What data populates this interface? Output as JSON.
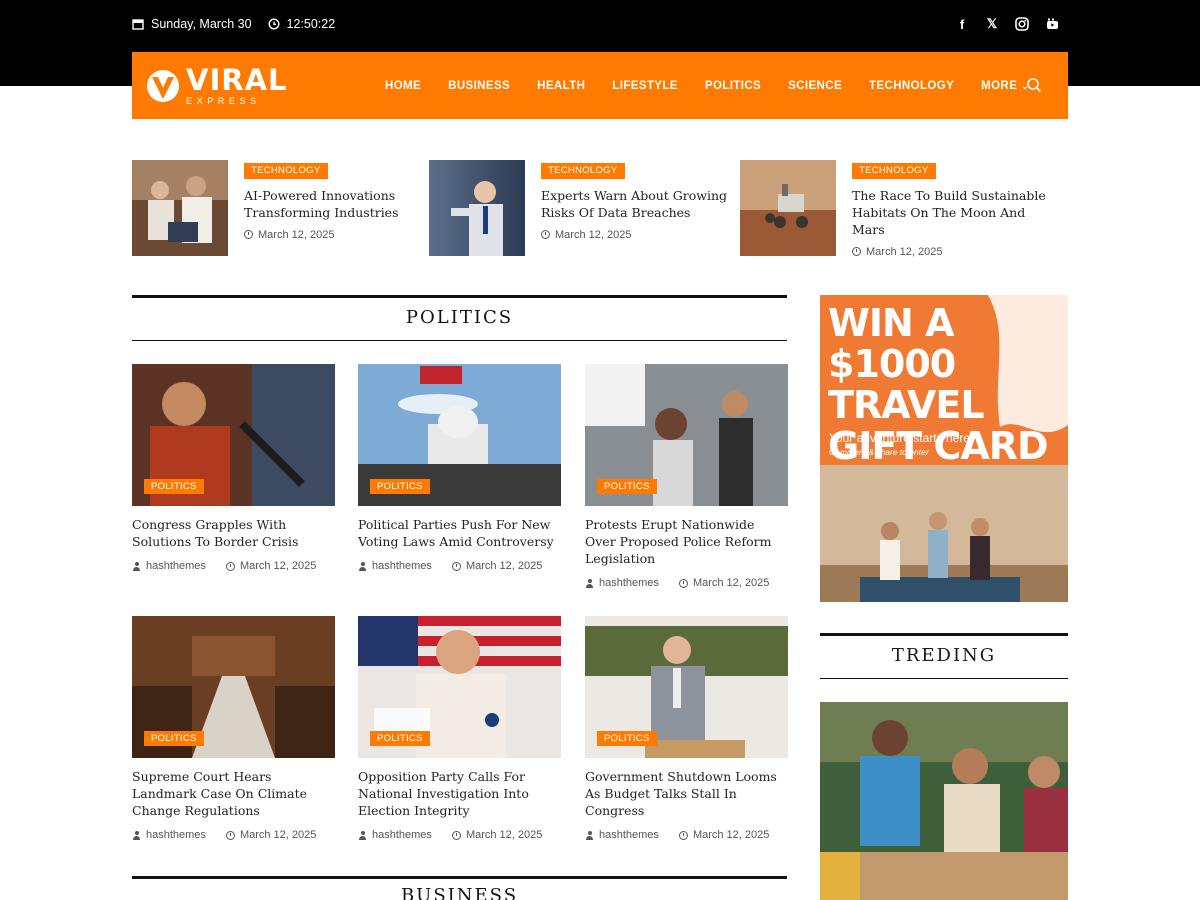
{
  "topbar": {
    "date": "Sunday, March 30",
    "time": "12:50:22",
    "social": [
      "facebook-icon",
      "x-icon",
      "instagram-icon",
      "youtube-icon"
    ]
  },
  "brand": {
    "name": "VIRAL",
    "tagline": "EXPRESS",
    "accent": "#ff7a00"
  },
  "nav": {
    "items": [
      "HOME",
      "BUSINESS",
      "HEALTH",
      "LIFESTYLE",
      "POLITICS",
      "SCIENCE",
      "TECHNOLOGY",
      "MORE"
    ]
  },
  "featured": [
    {
      "tag": "TECHNOLOGY",
      "title": "AI-Powered Innovations Transforming Industries",
      "date": "March 12, 2025"
    },
    {
      "tag": "TECHNOLOGY",
      "title": "Experts Warn About Growing Risks Of Data Breaches",
      "date": "March 12, 2025"
    },
    {
      "tag": "TECHNOLOGY",
      "title": "The Race To Build Sustainable Habitats On The Moon And Mars",
      "date": "March 12, 2025"
    }
  ],
  "politics": {
    "heading": "POLITICS",
    "cards": [
      {
        "tag": "POLITICS",
        "title": "Congress Grapples With Solutions To Border Crisis",
        "author": "hashthemes",
        "date": "March 12, 2025"
      },
      {
        "tag": "POLITICS",
        "title": "Political Parties Push For New Voting Laws Amid Controversy",
        "author": "hashthemes",
        "date": "March 12, 2025"
      },
      {
        "tag": "POLITICS",
        "title": "Protests Erupt Nationwide Over Proposed Police Reform Legislation",
        "author": "hashthemes",
        "date": "March 12, 2025"
      },
      {
        "tag": "POLITICS",
        "title": "Supreme Court Hears Landmark Case On Climate Change Regulations",
        "author": "hashthemes",
        "date": "March 12, 2025"
      },
      {
        "tag": "POLITICS",
        "title": "Opposition Party Calls For National Investigation Into Election Integrity",
        "author": "hashthemes",
        "date": "March 12, 2025"
      },
      {
        "tag": "POLITICS",
        "title": "Government Shutdown Looms As Budget Talks Stall In Congress",
        "author": "hashthemes",
        "date": "March 12, 2025"
      }
    ]
  },
  "business": {
    "heading": "BUSINESS"
  },
  "ad": {
    "line1": "WIN A $1000",
    "line2": "TRAVEL",
    "line3": "GIFT CARD",
    "sub": "Your adventure starts here.",
    "sub2": "Comment & share to enter"
  },
  "trending": {
    "heading": "TREDING"
  }
}
